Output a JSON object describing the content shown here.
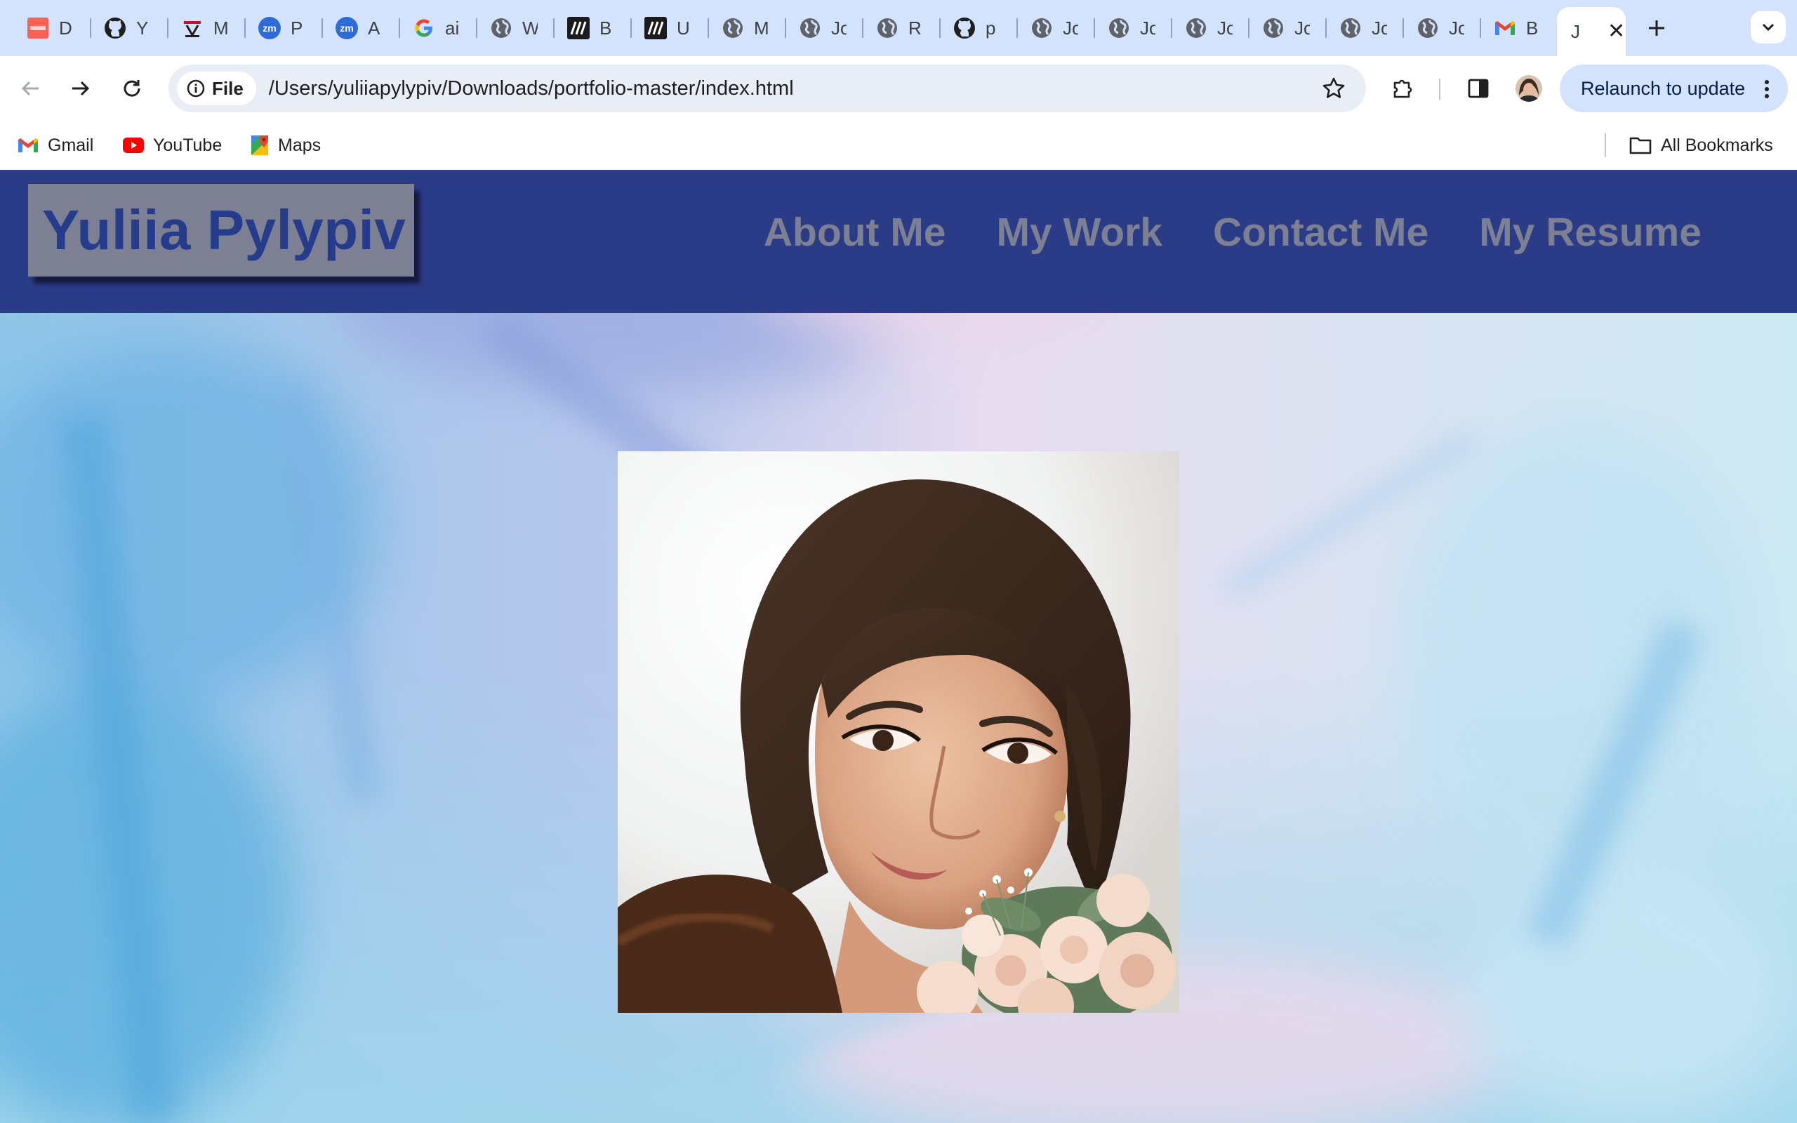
{
  "browser": {
    "tabs": [
      {
        "label": "D",
        "icon": "dayjs-icon"
      },
      {
        "label": "Y",
        "icon": "github-icon"
      },
      {
        "label": "M",
        "icon": "university-icon"
      },
      {
        "label": "P",
        "icon": "zoom-icon"
      },
      {
        "label": "A",
        "icon": "zoom-icon"
      },
      {
        "label": "ai",
        "icon": "google-icon"
      },
      {
        "label": "W",
        "icon": "globe-icon"
      },
      {
        "label": "B",
        "icon": "mdn-icon"
      },
      {
        "label": "U",
        "icon": "mdn-icon"
      },
      {
        "label": "M",
        "icon": "globe-icon"
      },
      {
        "label": "Jo",
        "icon": "globe-icon"
      },
      {
        "label": "R",
        "icon": "globe-icon"
      },
      {
        "label": "p",
        "icon": "github-icon"
      },
      {
        "label": "Jo",
        "icon": "globe-icon"
      },
      {
        "label": "Jo",
        "icon": "globe-icon"
      },
      {
        "label": "Jo",
        "icon": "globe-icon"
      },
      {
        "label": "Jo",
        "icon": "globe-icon"
      },
      {
        "label": "Jo",
        "icon": "globe-icon"
      },
      {
        "label": "Jo",
        "icon": "globe-icon"
      },
      {
        "label": "B",
        "icon": "gmail-icon"
      }
    ],
    "active_tab": {
      "label": "J"
    },
    "chip_label": "File",
    "url": "/Users/yuliiapylypiv/Downloads/portfolio-master/index.html",
    "relaunch_label": "Relaunch to update",
    "bookmarks": [
      {
        "label": "Gmail",
        "icon": "gmail-icon"
      },
      {
        "label": "YouTube",
        "icon": "youtube-icon"
      },
      {
        "label": "Maps",
        "icon": "maps-icon"
      }
    ],
    "all_bookmarks_label": "All Bookmarks"
  },
  "site": {
    "logo": "Yuliia Pylypiv",
    "nav": [
      "About Me",
      "My Work",
      "Contact Me",
      "My Resume"
    ],
    "colors": {
      "header": "#2a3b88",
      "logo_box": "#7c8092",
      "nav_text": "#7c8092",
      "logo_text": "#253b8c"
    }
  }
}
